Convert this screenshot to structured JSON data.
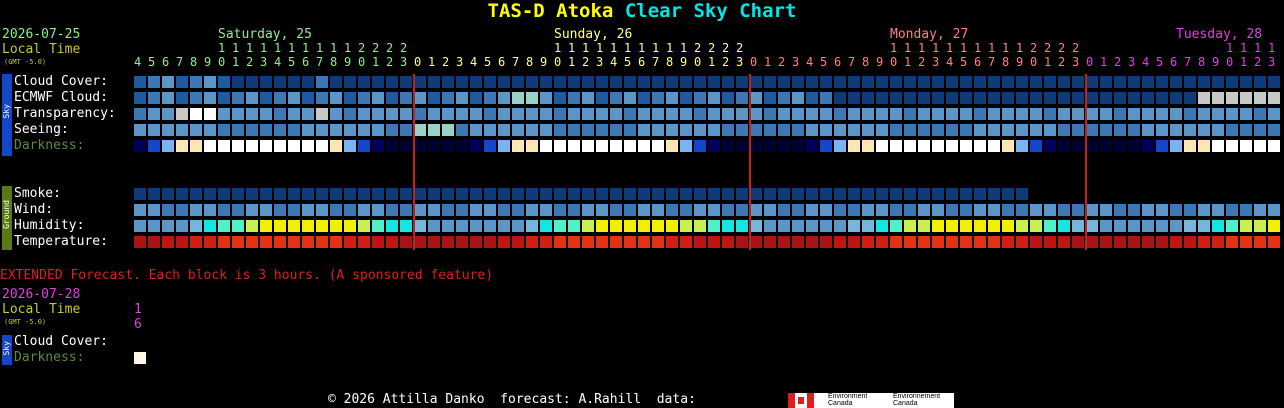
{
  "title": {
    "main": "TAS-D Atoka",
    "sub": "Clear Sky Chart"
  },
  "left_date": "2026-07-25",
  "local_time": "Local Time",
  "gmt": "(GMT -5.0)",
  "day_labels": [
    {
      "text": "Saturday, 25",
      "color": "#90ee90"
    },
    {
      "text": "Sunday, 26",
      "color": "#ffff90"
    },
    {
      "text": "Monday, 27",
      "color": "#ff8080"
    },
    {
      "text": "Tuesday, 28",
      "color": "#e040e0"
    }
  ],
  "hour_start": 4,
  "hour_count": 82,
  "hour_colors": [
    "#90ee90",
    "#ffff90",
    "#ff8080",
    "#e040e0"
  ],
  "sky_label": "Sky",
  "ground_label": "Ground",
  "rows_sky": [
    {
      "label": "Cloud Cover:",
      "key": "cloud"
    },
    {
      "label": "ECMWF Cloud:",
      "key": "ecmwf"
    },
    {
      "label": "Transparency:",
      "key": "transp"
    },
    {
      "label": "Seeing:",
      "key": "seeing"
    },
    {
      "label": "Darkness:",
      "key": "dark"
    }
  ],
  "rows_ground": [
    {
      "label": "Smoke:",
      "key": "smoke"
    },
    {
      "label": "Wind:",
      "key": "wind"
    },
    {
      "label": "Humidity:",
      "key": "hum"
    },
    {
      "label": "Temperature:",
      "key": "temp"
    }
  ],
  "palette": {
    "cloud": [
      "#0f3c78",
      "#1e5aa0",
      "#3c78b4",
      "#5a96c8",
      "#78b4dc",
      "#96c8e6",
      "#ffffff"
    ],
    "dark": [
      "#000032",
      "#00005a",
      "#001a8c",
      "#1446c8",
      "#3282dc",
      "#78b4f0",
      "#ffe6b4",
      "#ffffff"
    ]
  },
  "extended": {
    "note": "EXTENDED Forecast. Each block is 3 hours. (A sponsored feature)",
    "date": "2026-07-28",
    "local_time": "Local Time",
    "gmt": "(GMT -5.0)",
    "hour_top": "1",
    "hour_bottom": "6",
    "cloud_label": "Cloud Cover:",
    "dark_label": "Darkness:",
    "sky_label": "Sky"
  },
  "footer": {
    "text": "© 2026 Attilla Danko  forecast: A.Rahill  data:",
    "logo_left": "Environment Canada",
    "logo_right": "Environnement Canada"
  }
}
